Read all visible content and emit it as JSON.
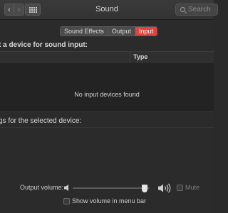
{
  "window": {
    "title": "Sound",
    "back_glyph": "‹",
    "forward_glyph": "›",
    "search_placeholder": "Search"
  },
  "tabs": [
    {
      "label": "Sound Effects",
      "active": false
    },
    {
      "label": "Output",
      "active": false
    },
    {
      "label": "Input",
      "active": true
    }
  ],
  "input": {
    "heading": "t a device for sound input:",
    "column_type": "Type",
    "empty_message": "No input devices found",
    "settings_heading": "gs for the selected device:"
  },
  "output_volume": {
    "label": "Output volume:",
    "level": 0.97,
    "mute_label": "Mute",
    "mute_checked": false
  },
  "menu_bar": {
    "label": "Show volume in menu bar",
    "checked": false
  },
  "colors": {
    "accent": "#e0443e",
    "background": "#2b2b2b"
  }
}
